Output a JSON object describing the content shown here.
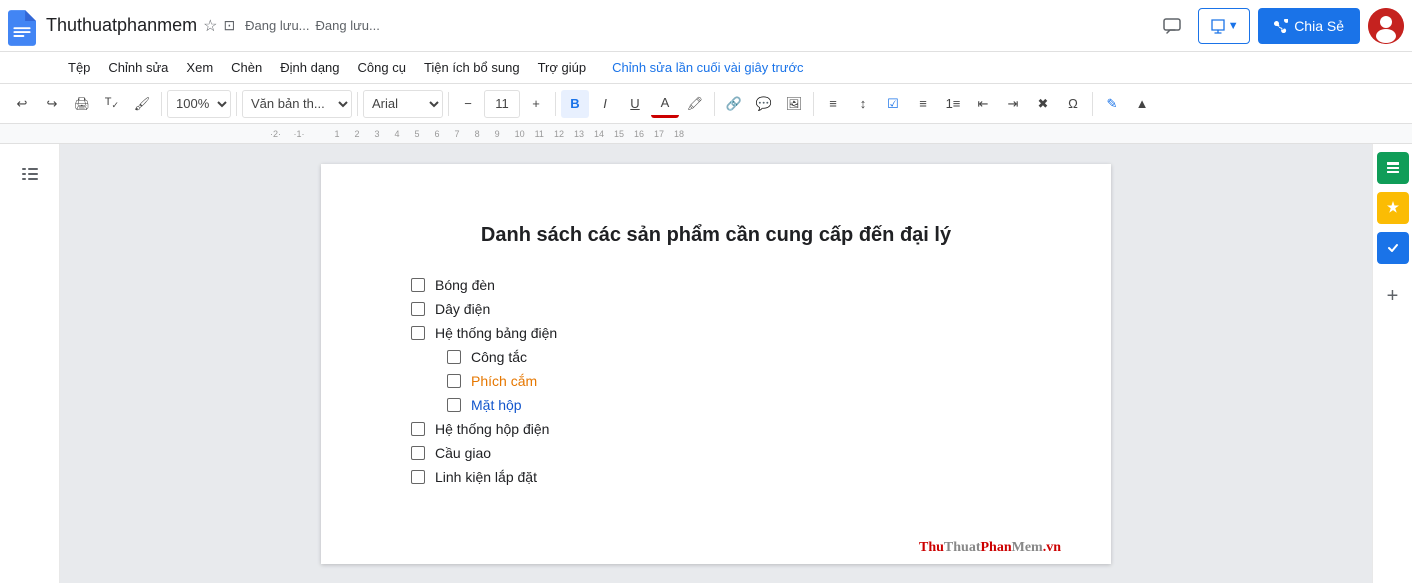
{
  "app": {
    "title": "Thuthuatphanmem",
    "saving_status": "Đang lưu...",
    "last_edit": "Chỉnh sửa lần cuối vài giây trước"
  },
  "menubar": {
    "items": [
      "Tệp",
      "Chỉnh sửa",
      "Xem",
      "Chèn",
      "Định dạng",
      "Công cụ",
      "Tiện ích bổ sung",
      "Trợ giúp"
    ]
  },
  "toolbar": {
    "zoom": "100%",
    "style": "Văn bản th...",
    "font": "Arial",
    "font_size": "11"
  },
  "share_button": "Chia Sẻ",
  "document": {
    "title": "Danh sách các sản phẩm cần cung cấp đến đại lý",
    "checklist": [
      {
        "text": "Bóng đèn",
        "color": "default",
        "level": 1
      },
      {
        "text": "Dây điện",
        "color": "default",
        "level": 1
      },
      {
        "text": "Hệ thống bảng điện",
        "color": "default",
        "level": 1
      },
      {
        "text": "Công tắc",
        "color": "default",
        "level": 2
      },
      {
        "text": "Phích cắm",
        "color": "orange",
        "level": 2
      },
      {
        "text": "Mặt hộp",
        "color": "blue",
        "level": 2
      },
      {
        "text": "Hệ thống hộp điện",
        "color": "default",
        "level": 1
      },
      {
        "text": "Cầu giao",
        "color": "default",
        "level": 1
      },
      {
        "text": "Linh kiện lắp đặt",
        "color": "default",
        "level": 1
      }
    ]
  },
  "watermark": {
    "thu": "Thu",
    "thuat": "Thuat",
    "phan": "Phan",
    "mem": "Mem",
    "dot_vn": ".vn"
  }
}
